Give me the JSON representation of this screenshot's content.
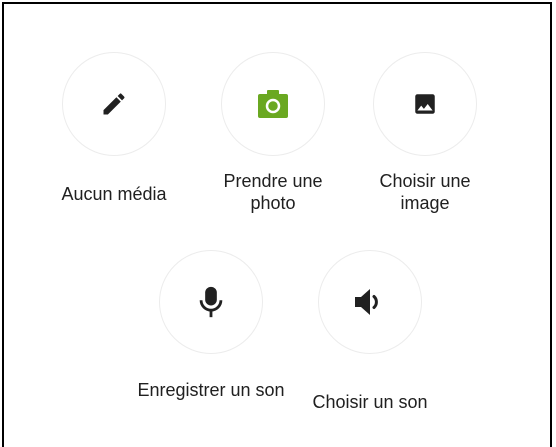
{
  "media_options": [
    {
      "id": "no-media",
      "label": "Aucun média",
      "icon": "pencil-icon"
    },
    {
      "id": "take-photo",
      "label": "Prendre une photo",
      "icon": "camera-icon",
      "icon_color": "#6aa821"
    },
    {
      "id": "choose-image",
      "label": "Choisir une image",
      "icon": "image-icon"
    },
    {
      "id": "record-sound",
      "label": "Enregistrer un son",
      "icon": "microphone-icon"
    },
    {
      "id": "choose-sound",
      "label": "Choisir un son",
      "icon": "speaker-icon"
    }
  ],
  "colors": {
    "icon_default": "#212121",
    "camera_green": "#6aa821",
    "circle_border": "#ececec",
    "label_text": "#202020"
  }
}
